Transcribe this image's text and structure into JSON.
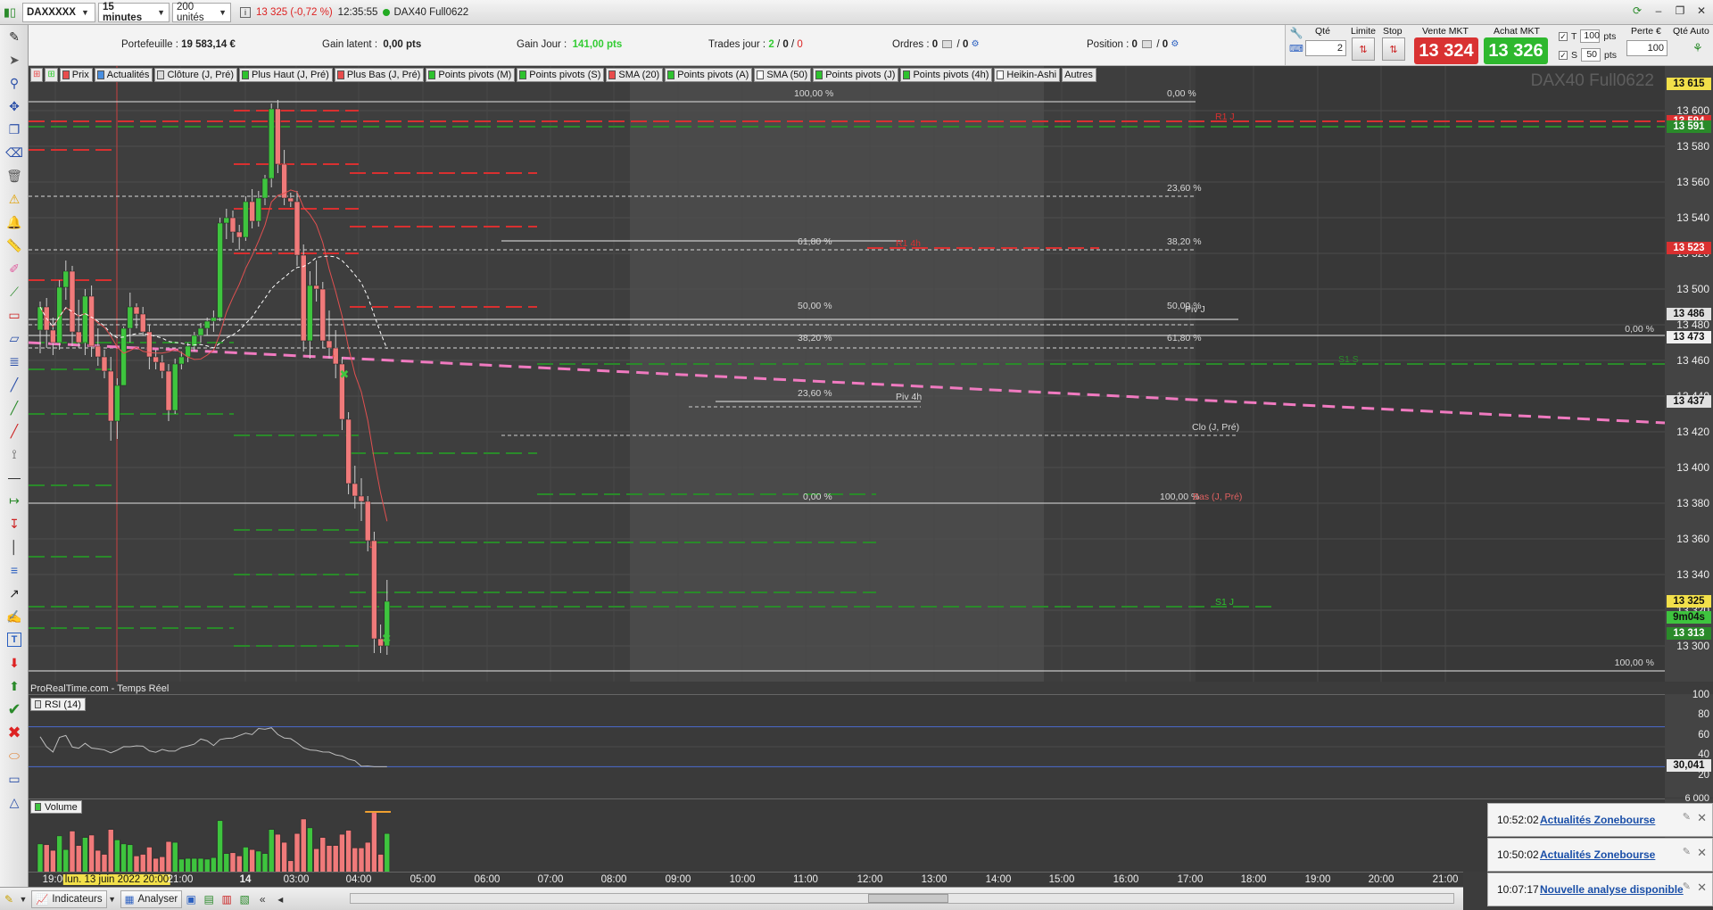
{
  "topbar": {
    "instrument": "DAXXXXX",
    "timeframe": "15 minutes",
    "units": "200 unités",
    "change": "13 325 (-0,72 %)",
    "time": "12:35:55",
    "contract": "DAX40 Full0622"
  },
  "info": {
    "portefeuille_label": "Portefeuille :",
    "portefeuille_value": "19 583,14 €",
    "gain_latent_label": "Gain latent :",
    "gain_latent_value": "0,00 pts",
    "gain_jour_label": "Gain Jour :",
    "gain_jour_value": "141,00 pts",
    "trades_label": "Trades jour :",
    "trades_a": "2",
    "trades_b": "0",
    "trades_c": "0",
    "ordres_label": "Ordres :",
    "ordres_a": "0",
    "ordres_b": "0",
    "position_label": "Position :",
    "position_a": "0",
    "position_b": "0"
  },
  "order": {
    "qty_label": "Qté",
    "qty_value": "2",
    "limit_label": "Limite",
    "stop_label": "Stop",
    "sell_label": "Vente MKT",
    "sell_price": "13 324",
    "buy_label": "Achat MKT",
    "buy_price": "13 326",
    "t_label": "T",
    "t_value": "100",
    "s_label": "S",
    "s_value": "50",
    "pts": "pts",
    "perte_label": "Perte €",
    "perte_value": "100",
    "qte_auto_label": "Qté Auto"
  },
  "indicators": [
    {
      "label": "Prix",
      "color": "#e84c4c"
    },
    {
      "label": "Actualités",
      "color": "#4a8fe0"
    },
    {
      "label": "Clôture (J, Pré)",
      "color": "#d8d8d8"
    },
    {
      "label": "Plus Haut (J, Pré)",
      "color": "#2ec22e"
    },
    {
      "label": "Plus Bas (J, Pré)",
      "color": "#e84c4c"
    },
    {
      "label": "Points pivots (M)",
      "color": "#2ec22e"
    },
    {
      "label": "Points pivots (S)",
      "color": "#2ec22e"
    },
    {
      "label": "SMA (20)",
      "color": "#e84c4c"
    },
    {
      "label": "Points pivots (A)",
      "color": "#2ec22e"
    },
    {
      "label": "SMA (50)",
      "color": "#ffffff"
    },
    {
      "label": "Points pivots (J)",
      "color": "#2ec22e"
    },
    {
      "label": "Points pivots (4h)",
      "color": "#2ec22e"
    },
    {
      "label": "Heikin-Ashi",
      "color": "#ffffff"
    },
    {
      "label": "Autres",
      "color": ""
    }
  ],
  "chart": {
    "watermark": "DAX40 Full0622",
    "source": "ProRealTime.com - Temps Réel",
    "fib_labels": {
      "f100_top": "100,00 %",
      "f0_topright": "0,00 %",
      "f236_a": "23,60 %",
      "f382_a": "38,20 %",
      "f618_b": "61,80 %",
      "f50_b": "50,00 %",
      "f50_a": "50,00 %",
      "f382_b": "38,20 %",
      "f618_a": "61,80 %",
      "f236_b": "23,60 %",
      "f0_b": "0,00 %",
      "f100_a": "100,00 %",
      "f0_right": "0,00 %",
      "f100_bottom": "100,00 %"
    },
    "level_labels": {
      "piv_j": "Piv J",
      "piv_4h": "Piv 4h",
      "clo": "Clo (J, Pré)",
      "bas": "Bas (J, Pré)",
      "s1j": "S1 J",
      "s1s": "S1 S",
      "r1j": "R1 J",
      "r1_4h": "R1 4h"
    }
  },
  "chart_data": {
    "type": "candlestick",
    "title": "DAX40 Full0622",
    "timeframe": "15 minutes",
    "y_range": [
      13280,
      13625
    ],
    "y_ticks": [
      13300,
      13320,
      13340,
      13360,
      13380,
      13400,
      13420,
      13440,
      13460,
      13480,
      13500,
      13520,
      13540,
      13560,
      13580,
      13600
    ],
    "y_tick_labels": [
      "13 300",
      "13 320",
      "13 340",
      "13 360",
      "13 380",
      "13 400",
      "13 420",
      "13 440",
      "13 460",
      "13 480",
      "13 500",
      "13 520",
      "13 540",
      "13 560",
      "13 580",
      "13 600"
    ],
    "price_tags": [
      {
        "label": "13 615",
        "value": 13615,
        "bg": "#f2e04a",
        "fg": "#111"
      },
      {
        "label": "13 594",
        "value": 13594,
        "bg": "#d93030",
        "fg": "#fff"
      },
      {
        "label": "13 591",
        "value": 13591,
        "bg": "#2a8a2a",
        "fg": "#fff"
      },
      {
        "label": "13 523",
        "value": 13523,
        "bg": "#d93030",
        "fg": "#fff"
      },
      {
        "label": "13 486",
        "value": 13486,
        "bg": "#e0e0e0",
        "fg": "#111"
      },
      {
        "label": "13 473",
        "value": 13473,
        "bg": "#f0f0f0",
        "fg": "#111"
      },
      {
        "label": "13 437",
        "value": 13437,
        "bg": "#e0e0e0",
        "fg": "#111"
      },
      {
        "label": "13 325",
        "value": 13325,
        "bg": "#f2e04a",
        "fg": "#111"
      },
      {
        "label": "9m04s",
        "value": 13316,
        "bg": "#3ec43e",
        "fg": "#111"
      },
      {
        "label": "13 313",
        "value": 13307,
        "bg": "#2a8a2a",
        "fg": "#fff"
      }
    ],
    "candles": [
      [
        13477,
        13493,
        13464,
        13490
      ],
      [
        13490,
        13495,
        13467,
        13477
      ],
      [
        13477,
        13484,
        13463,
        13470
      ],
      [
        13470,
        13505,
        13466,
        13501
      ],
      [
        13501,
        13516,
        13494,
        13510
      ],
      [
        13510,
        13513,
        13468,
        13476
      ],
      [
        13476,
        13494,
        13467,
        13470
      ],
      [
        13470,
        13500,
        13463,
        13496
      ],
      [
        13496,
        13502,
        13462,
        13468
      ],
      [
        13468,
        13478,
        13457,
        13462
      ],
      [
        13462,
        13466,
        13450,
        13454
      ],
      [
        13454,
        13462,
        13415,
        13426
      ],
      [
        13426,
        13450,
        13416,
        13446
      ],
      [
        13446,
        13479,
        13450,
        13478
      ],
      [
        13478,
        13498,
        13470,
        13490
      ],
      [
        13490,
        13492,
        13478,
        13486
      ],
      [
        13486,
        13490,
        13474,
        13476
      ],
      [
        13476,
        13480,
        13455,
        13462
      ],
      [
        13462,
        13466,
        13455,
        13459
      ],
      [
        13459,
        13463,
        13450,
        13454
      ],
      [
        13454,
        13458,
        13426,
        13432
      ],
      [
        13432,
        13461,
        13430,
        13458
      ],
      [
        13458,
        13465,
        13455,
        13462
      ],
      [
        13462,
        13470,
        13459,
        13468
      ],
      [
        13468,
        13476,
        13465,
        13474
      ],
      [
        13474,
        13481,
        13470,
        13478
      ],
      [
        13478,
        13484,
        13474,
        13482
      ],
      [
        13482,
        13488,
        13476,
        13484
      ],
      [
        13484,
        13540,
        13482,
        13537
      ],
      [
        13537,
        13545,
        13528,
        13540
      ],
      [
        13540,
        13544,
        13526,
        13532
      ],
      [
        13532,
        13536,
        13522,
        13529
      ],
      [
        13529,
        13552,
        13527,
        13549
      ],
      [
        13549,
        13556,
        13534,
        13538
      ],
      [
        13538,
        13555,
        13535,
        13551
      ],
      [
        13551,
        13564,
        13547,
        13562
      ],
      [
        13562,
        13604,
        13557,
        13601
      ],
      [
        13601,
        13606,
        13565,
        13570
      ],
      [
        13570,
        13578,
        13547,
        13551
      ],
      [
        13551,
        13554,
        13546,
        13549
      ],
      [
        13549,
        13555,
        13513,
        13519
      ],
      [
        13519,
        13525,
        13465,
        13471
      ],
      [
        13471,
        13510,
        13461,
        13502
      ],
      [
        13502,
        13516,
        13493,
        13500
      ],
      [
        13500,
        13504,
        13467,
        13471
      ],
      [
        13471,
        13488,
        13461,
        13467
      ],
      [
        13467,
        13477,
        13450,
        13458
      ],
      [
        13458,
        13462,
        13421,
        13427
      ],
      [
        13427,
        13431,
        13385,
        13391
      ],
      [
        13391,
        13401,
        13377,
        13384
      ],
      [
        13384,
        13394,
        13370,
        13381
      ],
      [
        13381,
        13384,
        13353,
        13359
      ],
      [
        13359,
        13364,
        13296,
        13304
      ],
      [
        13304,
        13312,
        13296,
        13300
      ],
      [
        13300,
        13337,
        13295,
        13325
      ]
    ]
  },
  "rsi": {
    "label": "RSI (14)",
    "ticks": [
      "100",
      "80",
      "60",
      "40",
      "20"
    ],
    "tag": "30,041",
    "last_value": 30.041
  },
  "volume": {
    "label": "Volume",
    "tick": "6 000"
  },
  "xaxis": {
    "labels": [
      {
        "t": "19:00",
        "x": 30
      },
      {
        "t": "lun. 13 juin 2022 20:00",
        "x": 99,
        "hl": true
      },
      {
        "t": "21:00",
        "x": 170
      },
      {
        "t": "14",
        "x": 243,
        "bold": true
      },
      {
        "t": "03:00",
        "x": 300
      },
      {
        "t": "04:00",
        "x": 370
      },
      {
        "t": "05:00",
        "x": 442
      },
      {
        "t": "06:00",
        "x": 514
      },
      {
        "t": "07:00",
        "x": 585
      },
      {
        "t": "08:00",
        "x": 656
      },
      {
        "t": "09:00",
        "x": 728
      },
      {
        "t": "10:00",
        "x": 800
      },
      {
        "t": "11:00",
        "x": 871
      },
      {
        "t": "12:00",
        "x": 943
      },
      {
        "t": "13:00",
        "x": 1015
      },
      {
        "t": "14:00",
        "x": 1087
      },
      {
        "t": "15:00",
        "x": 1158
      },
      {
        "t": "16:00",
        "x": 1230
      },
      {
        "t": "17:00",
        "x": 1302
      },
      {
        "t": "18:00",
        "x": 1373
      },
      {
        "t": "19:00",
        "x": 1445
      },
      {
        "t": "20:00",
        "x": 1516
      },
      {
        "t": "21:00",
        "x": 1588
      }
    ]
  },
  "bottom": {
    "indicateurs": "Indicateurs",
    "analyser": "Analyser"
  },
  "notifications": [
    {
      "time": "10:52:02",
      "msg": "Actualités Zonebourse"
    },
    {
      "time": "10:50:02",
      "msg": "Actualités Zonebourse"
    },
    {
      "time": "10:07:17",
      "msg": "Nouvelle analyse disponible"
    }
  ]
}
